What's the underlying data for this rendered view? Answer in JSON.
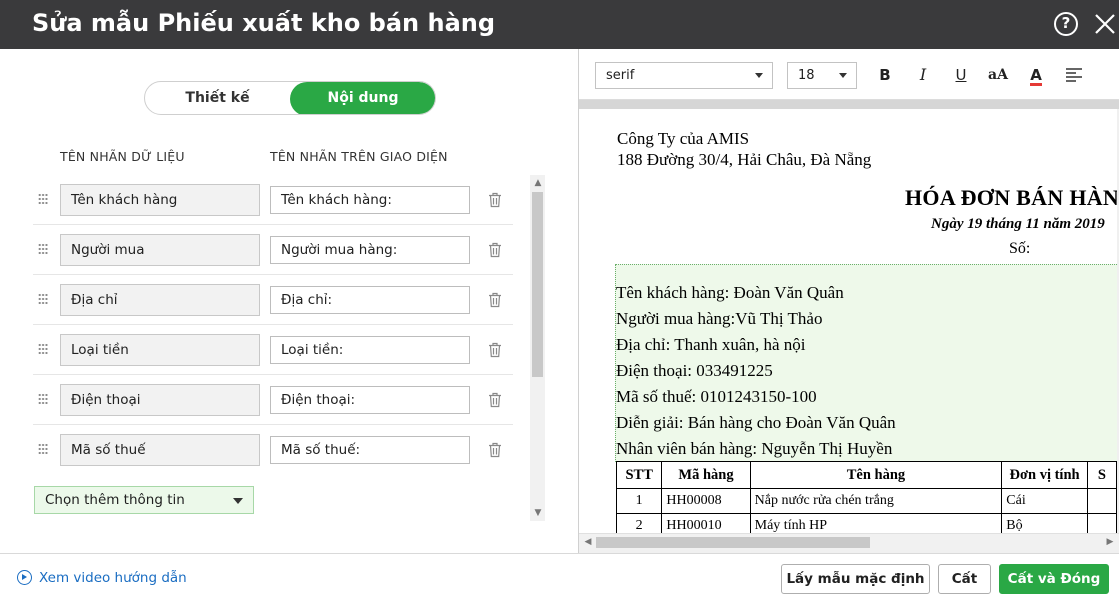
{
  "window": {
    "title": "Sửa mẫu Phiếu xuất kho bán hàng",
    "help_label": "?"
  },
  "tabs": {
    "design": "Thiết kế",
    "content": "Nội dung",
    "active": "content"
  },
  "columns": {
    "data_label": "TÊN NHÃN DỮ LIỆU",
    "ui_label": "TÊN NHÃN TRÊN GIAO DIỆN"
  },
  "fields": [
    {
      "data_label": "Tên khách hàng",
      "ui_label": "Tên khách hàng:"
    },
    {
      "data_label": "Người mua",
      "ui_label": "Người mua hàng:"
    },
    {
      "data_label": "Địa chỉ",
      "ui_label": "Địa chỉ:"
    },
    {
      "data_label": "Loại tiền",
      "ui_label": "Loại tiền:"
    },
    {
      "data_label": "Điện thoại",
      "ui_label": "Điện thoại:"
    },
    {
      "data_label": "Mã số thuế",
      "ui_label": "Mã số thuế:"
    }
  ],
  "add_info": {
    "label": "Chọn thêm thông tin"
  },
  "editor": {
    "font_family": "serif",
    "font_size": "18",
    "bold_label": "B",
    "italic_label": "I",
    "underline_label": "U",
    "case_label": "aA",
    "color_label": "A",
    "font_color": "#e53935"
  },
  "document": {
    "company_name": "Công Ty của AMIS",
    "company_address": "188 Đường 30/4, Hải Châu, Đà Nẵng",
    "invoice_title": "HÓA ĐƠN BÁN HÀNG",
    "invoice_date": "Ngày 19 tháng 11 năm 2019",
    "number_label": "Số:",
    "info_lines": [
      "Tên khách hàng: Đoàn Văn Quân",
      "Người mua hàng:Vũ Thị Thảo",
      "Địa chỉ: Thanh xuân, hà nội",
      "Điện thoại: 033491225",
      "Mã số thuế: 0101243150-100",
      "Diễn giải: Bán hàng cho Đoàn Văn Quân",
      "Nhân viên bán hàng: Nguyễn Thị Huyền"
    ],
    "table_headers": [
      "STT",
      "Mã hàng",
      "Tên hàng",
      "Đơn vị tính",
      "S"
    ],
    "table_rows": [
      [
        "1",
        "HH00008",
        "Nắp nước rửa chén trắng",
        "Cái",
        ""
      ],
      [
        "2",
        "HH00010",
        "Máy tính HP",
        "Bộ",
        ""
      ]
    ]
  },
  "footer": {
    "video_link": "Xem video hướng dẫn",
    "default_template_button": "Lấy mẫu mặc định",
    "save_button": "Cất",
    "save_close_button": "Cất và Đóng"
  },
  "colors": {
    "primary": "#2aa845",
    "titlebar": "#3a3a3c",
    "link": "#1a6dc2"
  }
}
